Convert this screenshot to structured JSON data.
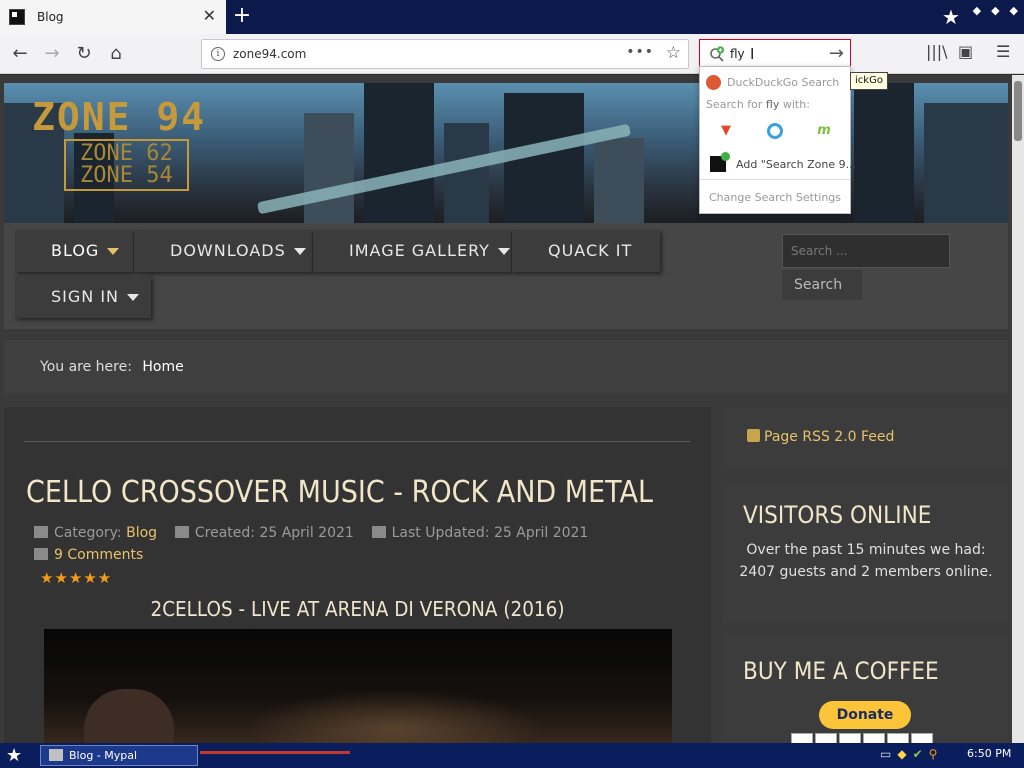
{
  "browser": {
    "tab_title": "Blog",
    "tab_close": "✕",
    "new_tab": "+",
    "url": "zone94.com",
    "page_actions": "•••",
    "search_query": "fly",
    "search_cursor": "I",
    "tooltip": "ickGo"
  },
  "search_dropdown": {
    "current_engine": "DuckDuckGo Search",
    "search_for_prefix": "Search for ",
    "search_for_term": "fly",
    "search_for_suffix": " with:",
    "engines": [
      "brave",
      "qwant",
      "mojeek"
    ],
    "add_engine": "Add \"Search Zone 9...",
    "change_settings": "Change Search Settings"
  },
  "site": {
    "logo_main": "ZONE 94",
    "logo_sub_1": "ZONE 62",
    "logo_sub_2": "ZONE 54",
    "menu": {
      "blog": "BLOG",
      "downloads": "DOWNLOADS",
      "image_gallery": "IMAGE GALLERY",
      "quack_it": "QUACK IT",
      "sign_in": "SIGN IN"
    },
    "search_placeholder": "Search ...",
    "search_button": "Search",
    "breadcrumb_prefix": "You are here:",
    "breadcrumb_current": "Home"
  },
  "article": {
    "title": "CELLO CROSSOVER MUSIC - ROCK AND METAL",
    "category_label": "Category:",
    "category": "Blog",
    "created": "Created: 25 April 2021",
    "updated": "Last Updated: 25 April 2021",
    "comments": "9 Comments",
    "rating_stars": 5,
    "stars_text": "★★★★★",
    "subtitle": "2CELLOS - LIVE AT ARENA DI VERONA (2016)"
  },
  "sidebar": {
    "rss": "Page RSS 2.0 Feed",
    "visitors_title": "VISITORS ONLINE",
    "visitors_text": "Over the past 15 minutes we had: 2407 guests and 2 members online.",
    "coffee_title": "BUY ME A COFFEE",
    "donate": "Donate"
  },
  "taskbar": {
    "task_label": "Blog - Mypal",
    "clock": "6:50 PM"
  },
  "colors": {
    "accent_gold": "#e6c36a",
    "search_border": "#d70022",
    "taskbar": "#0a1e5e"
  }
}
